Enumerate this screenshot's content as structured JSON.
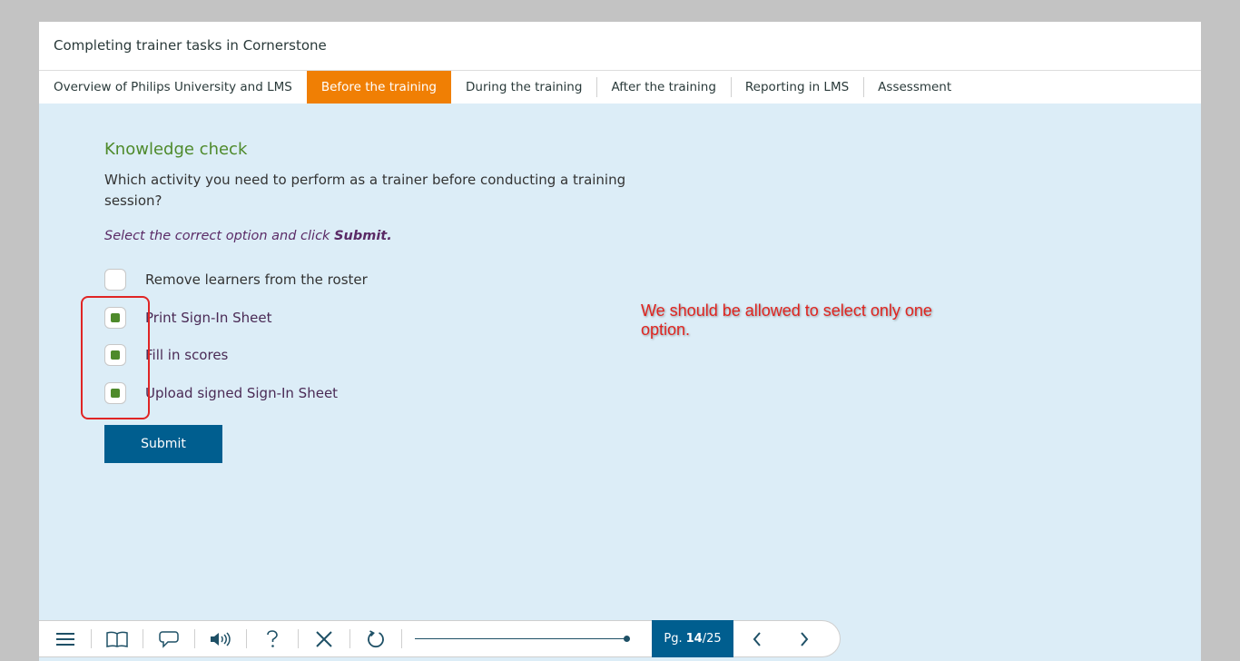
{
  "course": {
    "title": "Completing trainer tasks in Cornerstone"
  },
  "nav": {
    "tabs": [
      {
        "label": "Overview of Philips University and LMS",
        "active": false
      },
      {
        "label": "Before the training",
        "active": true
      },
      {
        "label": "During the training",
        "active": false
      },
      {
        "label": "After the training",
        "active": false
      },
      {
        "label": "Reporting in LMS",
        "active": false
      },
      {
        "label": "Assessment",
        "active": false
      }
    ]
  },
  "quiz": {
    "heading": "Knowledge check",
    "question": "Which activity you need to perform as a trainer before conducting a training session?",
    "instruction_prefix": "Select the correct option and click ",
    "instruction_bold": "Submit.",
    "options": [
      {
        "label": "Remove learners from the roster",
        "checked": false
      },
      {
        "label": "Print Sign-In Sheet",
        "checked": true
      },
      {
        "label": "Fill in scores",
        "checked": true
      },
      {
        "label": "Upload signed Sign-In Sheet",
        "checked": true
      }
    ],
    "submit_label": "Submit"
  },
  "annotation": {
    "text": "We should be allowed to select only one option."
  },
  "toolbar": {
    "icons": [
      "menu-icon",
      "book-icon",
      "comment-icon",
      "audio-icon",
      "help-icon",
      "close-icon",
      "refresh-icon"
    ],
    "page_prefix": "Pg.",
    "page_current": "14",
    "page_total": "/25",
    "progress_fraction": 0.99
  },
  "colors": {
    "accent_orange": "#f07f04",
    "primary_blue": "#005e8f",
    "check_green": "#4e8a2b",
    "annotation_red": "#e0241f",
    "content_bg": "#dcedf7"
  }
}
